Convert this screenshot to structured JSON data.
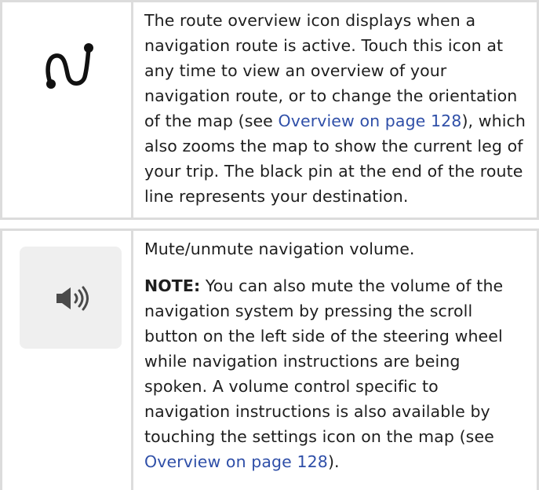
{
  "route_row": {
    "icon": "route-overview-icon",
    "text_1": "The route overview icon displays when a navigation route is active. Touch this icon at any time to view an overview of your navigation route, or to change the orientation of the map (see ",
    "link": "Overview on page 128",
    "text_2": "), which also zooms the map to show the current leg of your trip. The black pin at the end of the route line represents your destination."
  },
  "mute_row": {
    "icon": "volume-icon",
    "title": "Mute/unmute navigation volume.",
    "note_label": "NOTE:",
    "note_text_1": " You can also mute the volume of the navigation system by pressing the scroll button on the left side of the steering wheel while navigation instructions are being spoken. A volume control specific to navigation instructions is also available by touching the settings icon on the map (see ",
    "link": "Overview on page 128",
    "note_text_2": ")."
  },
  "colors": {
    "link": "#2f4fa8",
    "border": "#dcdcdc",
    "icon_box": "#efefef"
  }
}
